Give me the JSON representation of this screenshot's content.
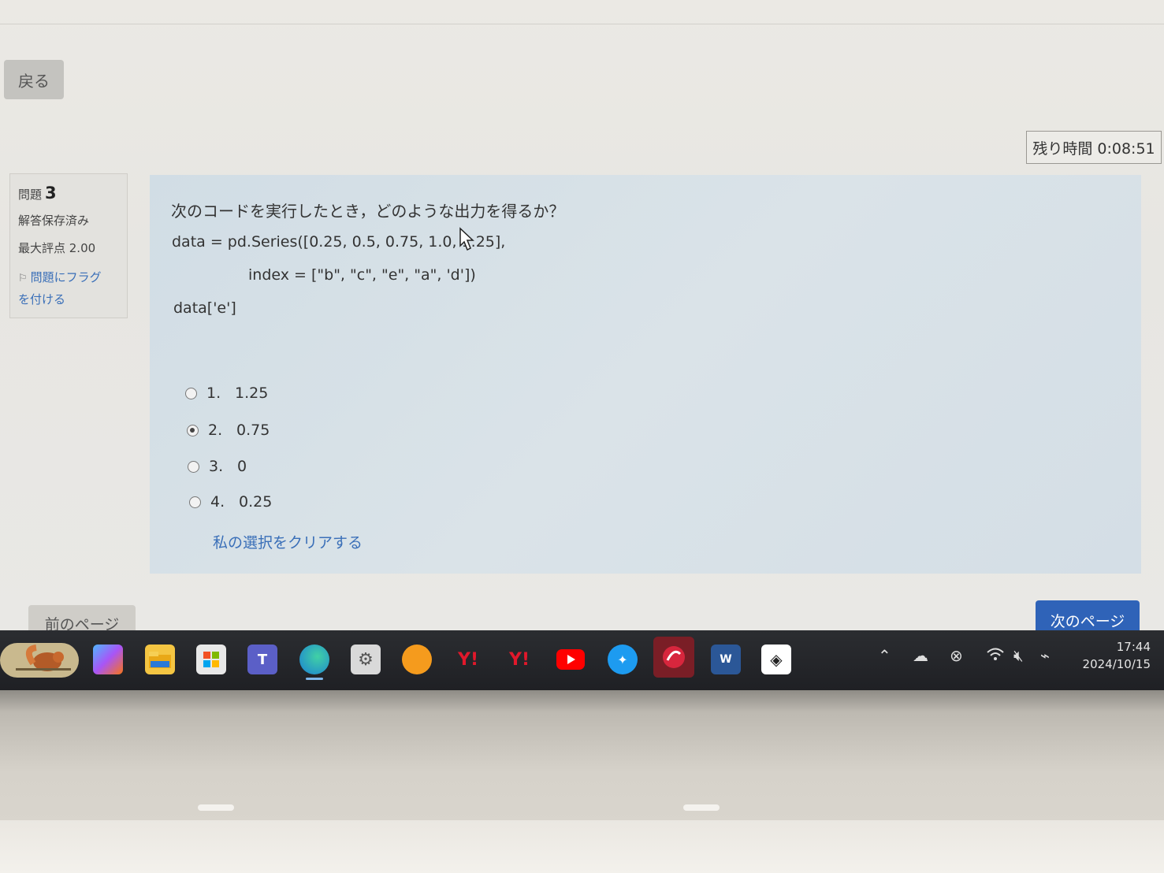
{
  "nav": {
    "back_label": "戻る",
    "timer": "残り時間 0:08:51"
  },
  "info": {
    "question_label": "問題",
    "question_number": "3",
    "status": "解答保存済み",
    "max_score": "最大評点 2.00",
    "flag_line1": "問題にフラグ",
    "flag_line2": "を付ける"
  },
  "question": {
    "text": "次のコードを実行したとき，どのような出力を得るか？",
    "code": [
      "data = pd.Series([0.25, 0.5, 0.75, 1.0, 1.25],",
      "index = [\"b\", \"c\", \"e\", \"a\", 'd'])",
      "data['e']"
    ],
    "options": [
      {
        "num": "1.",
        "value": "1.25",
        "selected": false
      },
      {
        "num": "2.",
        "value": "0.75",
        "selected": true
      },
      {
        "num": "3.",
        "value": "0",
        "selected": false
      },
      {
        "num": "4.",
        "value": "0.25",
        "selected": false
      }
    ],
    "clear_label": "私の選択をクリアする"
  },
  "footer": {
    "prev_label": "前のページ",
    "next_label": "次のページ"
  },
  "taskbar": {
    "apps": [
      "copilot-icon",
      "file-explorer-icon",
      "store-icon",
      "teams-icon",
      "edge-icon",
      "settings-icon",
      "app-orange-icon",
      "yahoo-icon",
      "yahoo-icon",
      "youtube-icon",
      "twitter-icon",
      "trend-micro-icon",
      "word-icon",
      "app-chat-icon"
    ],
    "time": "17:44",
    "date": "2024/10/15"
  },
  "colors": {
    "accent": "#2f63b8",
    "link": "#3a6fb8",
    "panel": "#d6e0e7"
  }
}
